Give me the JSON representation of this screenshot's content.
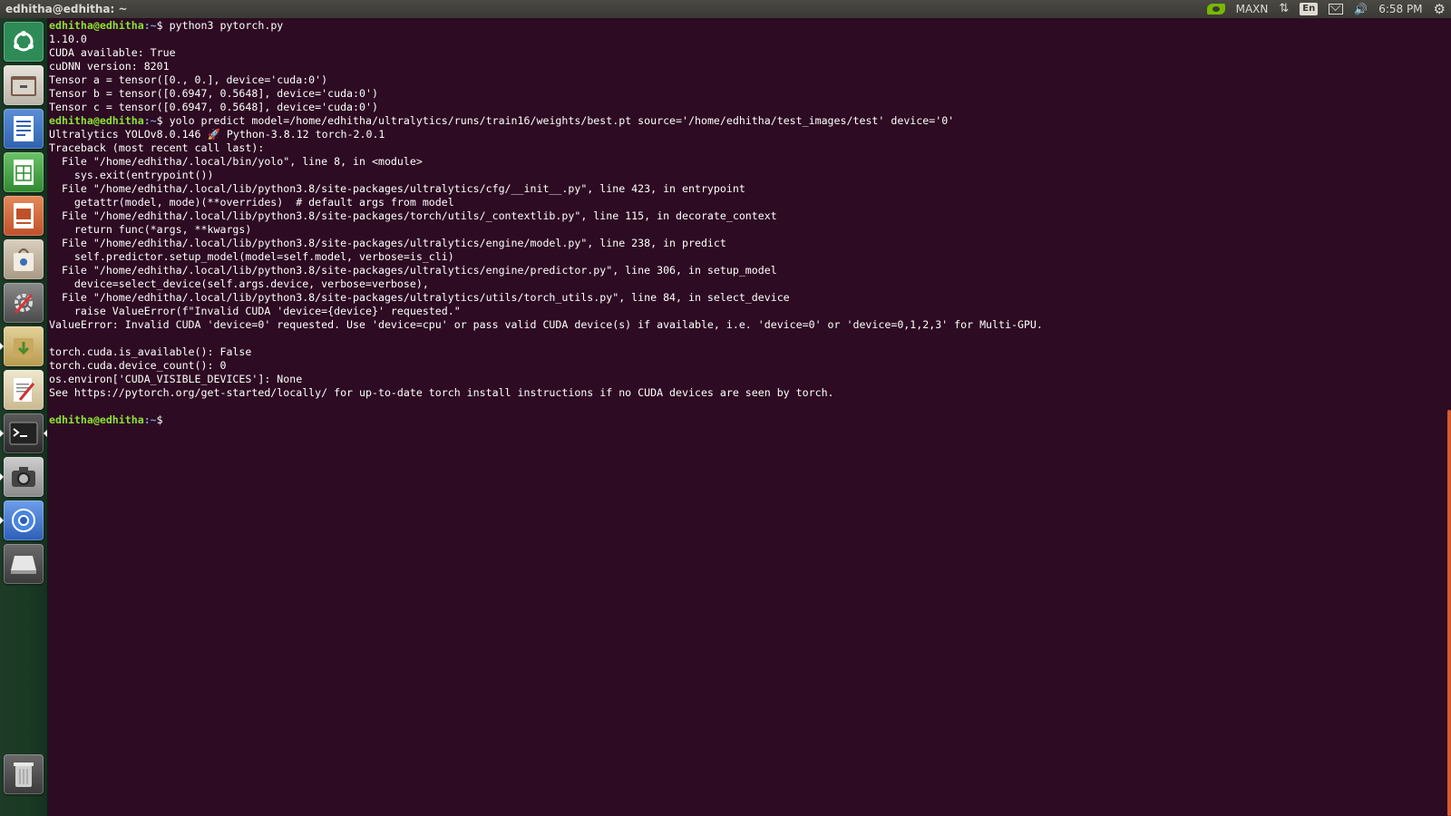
{
  "window": {
    "title": "edhitha@edhitha: ~"
  },
  "tray": {
    "mode_label": "MAXN",
    "keyboard_layout": "En",
    "clock": "6:58 PM",
    "icons": [
      "nvidia-icon",
      "network-arrows-icon",
      "keyboard-icon",
      "mail-icon",
      "volume-icon",
      "gear-icon"
    ]
  },
  "launcher": {
    "items": [
      "ubuntu-dash-icon",
      "files-icon",
      "writer-icon",
      "calc-icon",
      "impress-icon",
      "software-center-icon",
      "system-settings-icon",
      "package-installer-icon",
      "text-editor-icon",
      "terminal-icon",
      "camera-icon",
      "chromium-icon",
      "drive-icon",
      "trash-icon"
    ]
  },
  "terminal": {
    "prompt_user": "edhitha@edhitha",
    "prompt_path": ":~",
    "prompt_symbol": "$",
    "lines": [
      {
        "type": "cmd",
        "text": " python3 pytorch.py"
      },
      {
        "type": "out",
        "text": "1.10.0"
      },
      {
        "type": "out",
        "text": "CUDA available: True"
      },
      {
        "type": "out",
        "text": "cuDNN version: 8201"
      },
      {
        "type": "out",
        "text": "Tensor a = tensor([0., 0.], device='cuda:0')"
      },
      {
        "type": "out",
        "text": "Tensor b = tensor([0.6947, 0.5648], device='cuda:0')"
      },
      {
        "type": "out",
        "text": "Tensor c = tensor([0.6947, 0.5648], device='cuda:0')"
      },
      {
        "type": "cmd",
        "text": " yolo predict model=/home/edhitha/ultralytics/runs/train16/weights/best.pt source='/home/edhitha/test_images/test' device='0'"
      },
      {
        "type": "out",
        "text": "Ultralytics YOLOv8.0.146 🚀 Python-3.8.12 torch-2.0.1"
      },
      {
        "type": "out",
        "text": "Traceback (most recent call last):"
      },
      {
        "type": "out",
        "text": "  File \"/home/edhitha/.local/bin/yolo\", line 8, in <module>"
      },
      {
        "type": "out",
        "text": "    sys.exit(entrypoint())"
      },
      {
        "type": "out",
        "text": "  File \"/home/edhitha/.local/lib/python3.8/site-packages/ultralytics/cfg/__init__.py\", line 423, in entrypoint"
      },
      {
        "type": "out",
        "text": "    getattr(model, mode)(**overrides)  # default args from model"
      },
      {
        "type": "out",
        "text": "  File \"/home/edhitha/.local/lib/python3.8/site-packages/torch/utils/_contextlib.py\", line 115, in decorate_context"
      },
      {
        "type": "out",
        "text": "    return func(*args, **kwargs)"
      },
      {
        "type": "out",
        "text": "  File \"/home/edhitha/.local/lib/python3.8/site-packages/ultralytics/engine/model.py\", line 238, in predict"
      },
      {
        "type": "out",
        "text": "    self.predictor.setup_model(model=self.model, verbose=is_cli)"
      },
      {
        "type": "out",
        "text": "  File \"/home/edhitha/.local/lib/python3.8/site-packages/ultralytics/engine/predictor.py\", line 306, in setup_model"
      },
      {
        "type": "out",
        "text": "    device=select_device(self.args.device, verbose=verbose),"
      },
      {
        "type": "out",
        "text": "  File \"/home/edhitha/.local/lib/python3.8/site-packages/ultralytics/utils/torch_utils.py\", line 84, in select_device"
      },
      {
        "type": "out",
        "text": "    raise ValueError(f\"Invalid CUDA 'device={device}' requested.\""
      },
      {
        "type": "out",
        "text": "ValueError: Invalid CUDA 'device=0' requested. Use 'device=cpu' or pass valid CUDA device(s) if available, i.e. 'device=0' or 'device=0,1,2,3' for Multi-GPU."
      },
      {
        "type": "out",
        "text": ""
      },
      {
        "type": "out",
        "text": "torch.cuda.is_available(): False"
      },
      {
        "type": "out",
        "text": "torch.cuda.device_count(): 0"
      },
      {
        "type": "out",
        "text": "os.environ['CUDA_VISIBLE_DEVICES']: None"
      },
      {
        "type": "out",
        "text": "See https://pytorch.org/get-started/locally/ for up-to-date torch install instructions if no CUDA devices are seen by torch."
      },
      {
        "type": "out",
        "text": ""
      },
      {
        "type": "cmd",
        "text": " "
      }
    ]
  },
  "colors": {
    "terminal_bg": "#2d0b22",
    "prompt_user": "#8ae234",
    "prompt_path": "#729fcf",
    "scrollbar": "#d65a31"
  }
}
